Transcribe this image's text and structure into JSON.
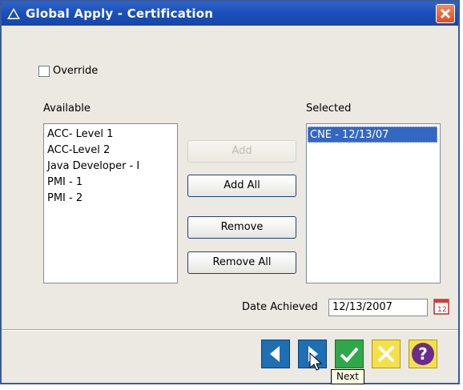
{
  "window": {
    "title": "Global Apply - Certification"
  },
  "override": {
    "label": "Override",
    "checked": false
  },
  "available": {
    "label": "Available",
    "items": [
      "ACC- Level 1",
      "ACC-Level 2",
      "Java Developer - I",
      "PMI - 1",
      "PMI - 2"
    ]
  },
  "selected": {
    "label": "Selected",
    "items": [
      "CNE - 12/13/07"
    ]
  },
  "buttons": {
    "add": "Add",
    "add_all": "Add All",
    "remove": "Remove",
    "remove_all": "Remove All"
  },
  "date_achieved": {
    "label": "Date Achieved",
    "value": "12/13/2007"
  },
  "tooltip": {
    "text": "Next"
  },
  "colors": {
    "titlebar": "#1a4fb8",
    "nav_blue": "#1f6fb5",
    "ok_green": "#2fa84a",
    "cancel_yellow": "#f4e04a",
    "help_purple": "#6b2a8c",
    "selection": "#3467c2"
  },
  "icons": [
    "warning-triangle-icon",
    "close-icon",
    "calendar-icon",
    "previous-arrow-icon",
    "next-arrow-icon",
    "ok-check-icon",
    "cancel-x-icon",
    "help-question-icon",
    "mouse-cursor-icon"
  ]
}
